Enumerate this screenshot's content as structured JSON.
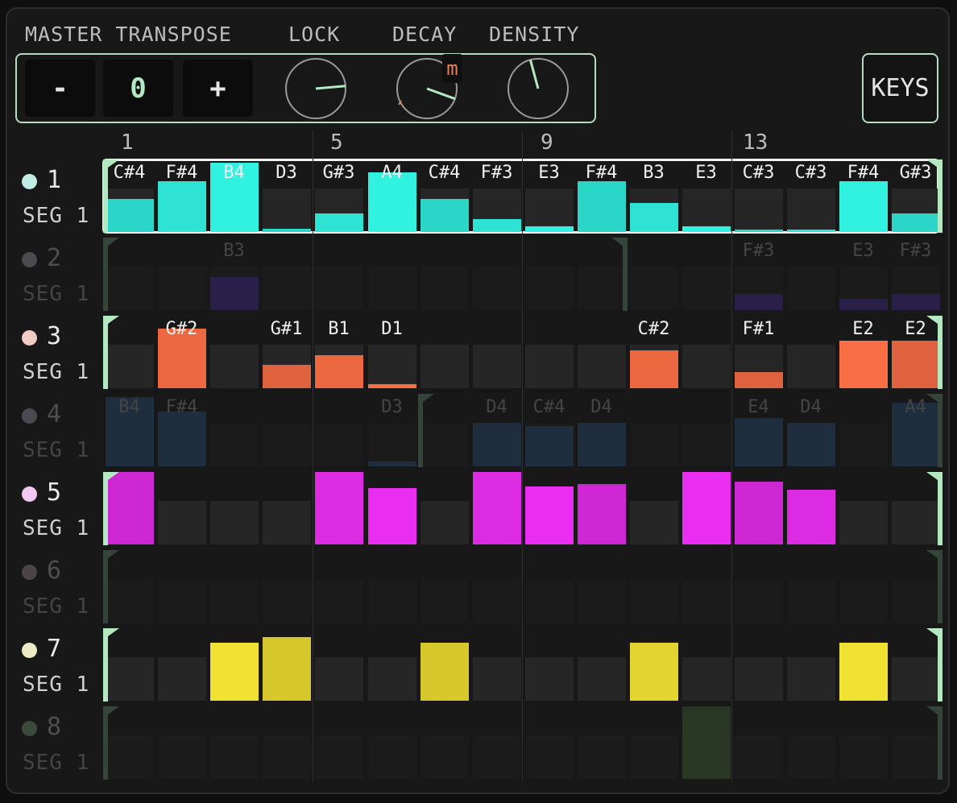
{
  "header": {
    "master_transpose_label": "MASTER TRANSPOSE",
    "lock_label": "LOCK",
    "decay_label": "DECAY",
    "density_label": "DENSITY",
    "minus_label": "-",
    "transpose_value": "0",
    "plus_label": "+",
    "keys_label": "KEYS",
    "decay_badge": "m"
  },
  "knobs": {
    "lock_angle_deg": 85,
    "decay_angle_deg": 110,
    "density_angle_deg": -15
  },
  "step_numbers": [
    "1",
    "5",
    "9",
    "13"
  ],
  "tracks": [
    {
      "num": "1",
      "seg": "SEG 1",
      "active": true,
      "selected": true,
      "color": "#2fe8d8",
      "dot": "#bfece4",
      "loop": [
        0,
        16
      ],
      "notes": [
        "C#4",
        "F#4",
        "B4",
        "D3",
        "G#3",
        "A4",
        "C#4",
        "F#3",
        "E3",
        "F#4",
        "B3",
        "E3",
        "C#3",
        "C#3",
        "F#4",
        "G#3"
      ],
      "levels": [
        0.45,
        0.7,
        0.95,
        0.04,
        0.25,
        0.82,
        0.45,
        0.18,
        0.08,
        0.7,
        0.4,
        0.08,
        0.03,
        0.03,
        0.7,
        0.25
      ]
    },
    {
      "num": "2",
      "seg": "SEG 1",
      "active": false,
      "color": "#3a2670",
      "dot": "#4a4a50",
      "loop": [
        0,
        10
      ],
      "notes": [
        "",
        "",
        "B3",
        "",
        "",
        "",
        "",
        "",
        "",
        "",
        "",
        "",
        "F#3",
        "",
        "E3",
        "F#3"
      ],
      "levels": [
        0,
        0,
        0.45,
        0,
        0,
        0,
        0,
        0,
        0,
        0,
        0,
        0,
        0.22,
        0,
        0.15,
        0.22
      ]
    },
    {
      "num": "3",
      "seg": "SEG 1",
      "active": true,
      "color": "#f06a42",
      "dot": "#f2ccc4",
      "loop": [
        0,
        16
      ],
      "notes": [
        "",
        "G#2",
        "",
        "G#1",
        "B1",
        "D1",
        "",
        "",
        "",
        "",
        "C#2",
        "",
        "F#1",
        "",
        "E2",
        "E2"
      ],
      "levels": [
        0,
        0.82,
        0,
        0.32,
        0.45,
        0.05,
        0,
        0,
        0,
        0,
        0.52,
        0,
        0.22,
        0,
        0.65,
        0.65
      ]
    },
    {
      "num": "4",
      "seg": "SEG 1",
      "active": false,
      "color": "#24405e",
      "dot": "#4a4a50",
      "loop": [
        6,
        16
      ],
      "notes": [
        "B4",
        "F#4",
        "",
        "",
        "",
        "D3",
        "",
        "D4",
        "C#4",
        "D4",
        "",
        "",
        "E4",
        "D4",
        "",
        "A4"
      ],
      "levels": [
        0.96,
        0.75,
        0,
        0,
        0,
        0.07,
        0,
        0.6,
        0.55,
        0.6,
        0,
        0,
        0.67,
        0.6,
        0,
        0.88
      ]
    },
    {
      "num": "5",
      "seg": "SEG 1",
      "active": true,
      "color": "#e02ce8",
      "dot": "#f0c8f0",
      "loop": [
        0,
        16
      ],
      "notes": [
        "",
        "",
        "",
        "",
        "",
        "",
        "",
        "",
        "",
        "",
        "",
        "",
        "",
        "",
        "",
        ""
      ],
      "levels": [
        1.0,
        0,
        0,
        0,
        1.0,
        0.78,
        0,
        1.0,
        0.8,
        0.83,
        0,
        1.0,
        0.87,
        0.76,
        0,
        0
      ]
    },
    {
      "num": "6",
      "seg": "SEG 1",
      "active": false,
      "color": "#444444",
      "dot": "#4c4448",
      "loop": [
        0,
        16
      ],
      "notes": [
        "",
        "",
        "",
        "",
        "",
        "",
        "",
        "",
        "",
        "",
        "",
        "",
        "",
        "",
        "",
        ""
      ],
      "levels": [
        0,
        0,
        0,
        0,
        0,
        0,
        0,
        0,
        0,
        0,
        0,
        0,
        0,
        0,
        0,
        0
      ]
    },
    {
      "num": "7",
      "seg": "SEG 1",
      "active": true,
      "color": "#e8d830",
      "dot": "#ecebc4",
      "loop": [
        0,
        16
      ],
      "notes": [
        "",
        "",
        "",
        "",
        "",
        "",
        "",
        "",
        "",
        "",
        "",
        "",
        "",
        "",
        "",
        ""
      ],
      "levels": [
        0,
        0,
        0.8,
        0.88,
        0,
        0,
        0.8,
        0,
        0,
        0,
        0.8,
        0,
        0,
        0,
        0.8,
        0
      ]
    },
    {
      "num": "8",
      "seg": "SEG 1",
      "active": false,
      "color": "#37522c",
      "dot": "#3c4a3c",
      "loop": [
        0,
        16
      ],
      "notes": [
        "",
        "",
        "",
        "",
        "",
        "",
        "",
        "",
        "",
        "",
        "",
        "",
        "",
        "",
        "",
        ""
      ],
      "levels": [
        0,
        0,
        0,
        0,
        0,
        0,
        0,
        0,
        0,
        0,
        0,
        1.0,
        0,
        0,
        0,
        0
      ]
    }
  ]
}
